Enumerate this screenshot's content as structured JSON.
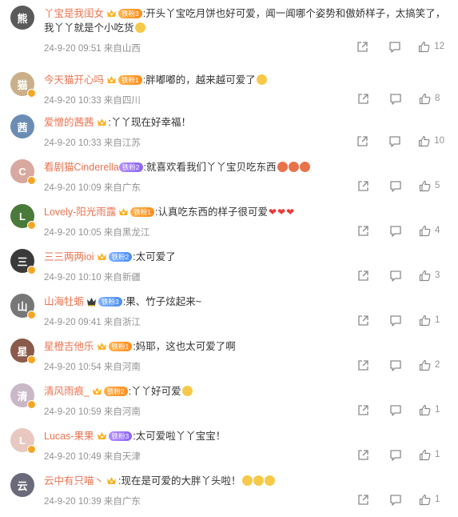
{
  "comments": [
    {
      "user": "丫宝是我闺女",
      "badge": "铁粉3",
      "badge_style": "orange",
      "text": ":开头丫宝吃月饼也好可爱，闻一闻哪个姿势和傲娇样子，太搞笑了，我丫丫就是个小吃货",
      "emojis": [
        "grin"
      ],
      "time": "24-9-20 09:51",
      "location": "来自山西",
      "likes": "12",
      "avatar_color": "#5a5a5a",
      "avatar_letter": "熊"
    },
    {
      "user": "今天猫开心吗",
      "badge": "铁粉1",
      "badge_style": "orange",
      "text": ":胖嘟嘟的，越来越可爱了",
      "emojis": [
        "kiss"
      ],
      "time": "24-9-20 10:33",
      "location": "来自四川",
      "likes": "8",
      "avatar_color": "#c9b08a",
      "avatar_letter": "猫"
    },
    {
      "user": "爱憎的茜茜",
      "badge": "",
      "badge_style": "",
      "text": ":丫丫现在好幸福！",
      "emojis": [],
      "time": "24-9-20 10:33",
      "location": "来自江苏",
      "likes": "10",
      "avatar_color": "#6b8db5",
      "avatar_letter": "茜"
    },
    {
      "user": "看剧猫Cinderella",
      "badge": "铁粉2",
      "badge_style": "purple",
      "text": ":就喜欢看我们丫丫宝贝吃东西",
      "emojis": [
        "food",
        "food",
        "food"
      ],
      "time": "24-9-20 10:09",
      "location": "来自广东",
      "likes": "5",
      "avatar_color": "#d8a9a0",
      "avatar_letter": "C"
    },
    {
      "user": "Lovely-阳光雨露",
      "badge": "铁粉1",
      "badge_style": "orange",
      "text": ":认真吃东西的样子很可爱",
      "hearts": 3,
      "emojis": [],
      "time": "24-9-20 10:05",
      "location": "来自黑龙江",
      "likes": "4",
      "avatar_color": "#4a7a3a",
      "avatar_letter": "L"
    },
    {
      "user": "三三两两ioi",
      "badge": "铁粉2",
      "badge_style": "blue",
      "text": ":太可爱了",
      "emojis": [],
      "time": "24-9-20 10:10",
      "location": "来自新疆",
      "likes": "3",
      "avatar_color": "#3a3a3a",
      "avatar_letter": "三"
    },
    {
      "user": "山海牡蛎",
      "badge": "铁粉3",
      "badge_style": "blue",
      "text": ":果、竹子炫起来~",
      "emojis": [],
      "time": "24-9-20 09:41",
      "location": "来自浙江",
      "likes": "1",
      "avatar_color": "#777777",
      "avatar_letter": "山"
    },
    {
      "user": "星橙吉他乐",
      "badge": "铁粉1",
      "badge_style": "orange",
      "text": ":妈耶，这也太可爱了啊",
      "emojis": [],
      "time": "24-9-20 10:54",
      "location": "来自河南",
      "likes": "2",
      "avatar_color": "#8a5a4a",
      "avatar_letter": "星"
    },
    {
      "user": "清风雨痕_",
      "badge": "铁粉2",
      "badge_style": "orange",
      "text": ":丫丫好可爱",
      "emojis": [
        "grin"
      ],
      "time": "24-9-20 10:59",
      "location": "来自河南",
      "likes": "1",
      "avatar_color": "#c8b8c8",
      "avatar_letter": "清"
    },
    {
      "user": "Lucas-果果",
      "badge": "铁粉3",
      "badge_style": "purple",
      "text": ":太可爱啦丫丫宝宝！",
      "emojis": [],
      "time": "24-9-20 10:49",
      "location": "来自天津",
      "likes": "1",
      "avatar_color": "#e8c8c0",
      "avatar_letter": "L"
    },
    {
      "user": "云中有只喵丶",
      "badge": "",
      "badge_style": "",
      "text": ":现在是可爱的大胖丫头啦！",
      "emojis": [
        "cry",
        "cry",
        "cry"
      ],
      "time": "24-9-20 10:39",
      "location": "来自广东",
      "likes": "1",
      "avatar_color": "#6a6a7a",
      "avatar_letter": "云"
    }
  ],
  "icons": {
    "share": "share-icon",
    "reply": "reply-icon",
    "like": "thumbs-up-icon",
    "crown": "crown-icon",
    "verified": "verified-icon"
  }
}
